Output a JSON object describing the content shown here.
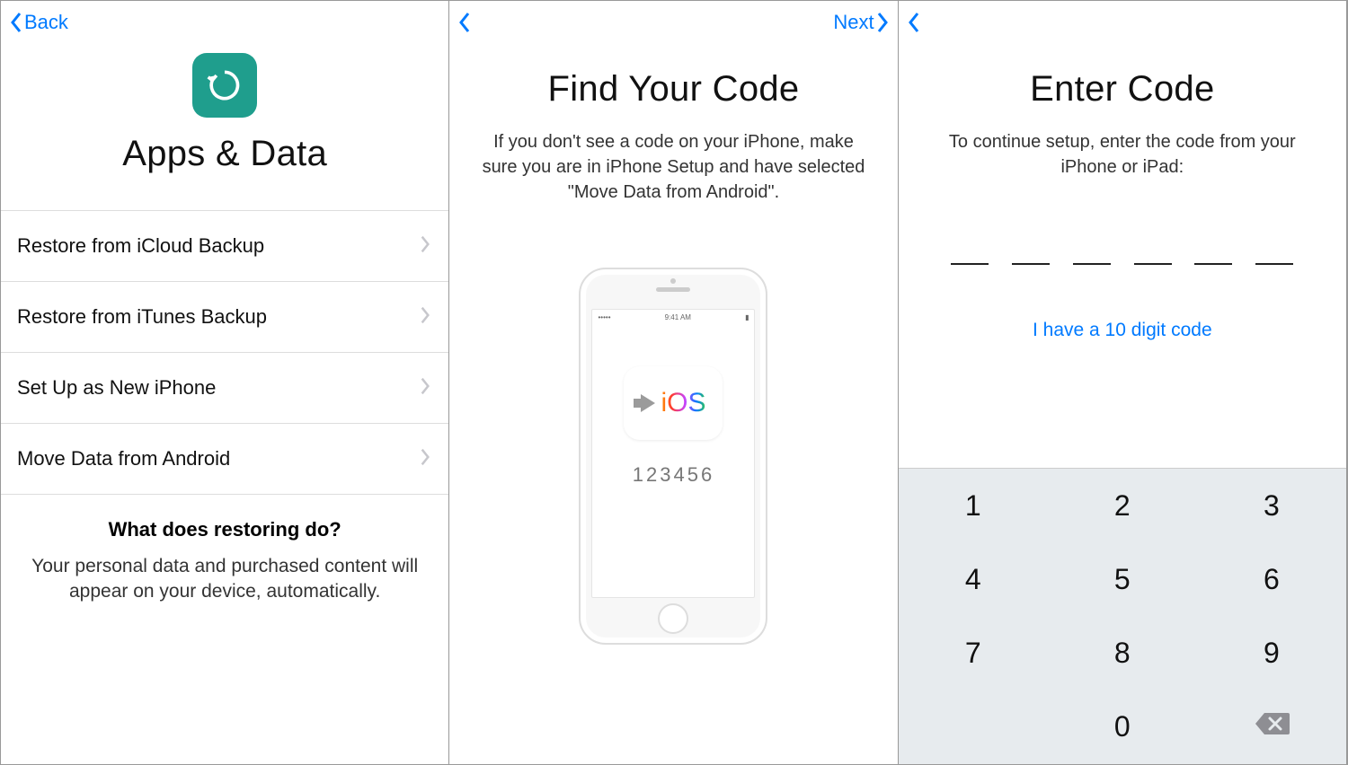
{
  "panel1": {
    "back_label": "Back",
    "title": "Apps & Data",
    "options": [
      "Restore from iCloud Backup",
      "Restore from iTunes Backup",
      "Set Up as New iPhone",
      "Move Data from Android"
    ],
    "footer_heading": "What does restoring do?",
    "footer_body": "Your personal data and purchased content will appear on your device, automatically."
  },
  "panel2": {
    "next_label": "Next",
    "title": "Find Your Code",
    "subtitle": "If you don't see a code on your iPhone, make sure you are in iPhone Setup and have selected \"Move Data from Android\".",
    "phone_status_time": "9:41 AM",
    "ios_label": "iOS",
    "sample_code": "123456"
  },
  "panel3": {
    "title": "Enter Code",
    "subtitle": "To continue setup, enter the code from your iPhone or iPad:",
    "alt_link": "I have a 10 digit code",
    "code_slots": 6,
    "keys": [
      "1",
      "2",
      "3",
      "4",
      "5",
      "6",
      "7",
      "8",
      "9",
      "",
      "0",
      "del"
    ]
  }
}
